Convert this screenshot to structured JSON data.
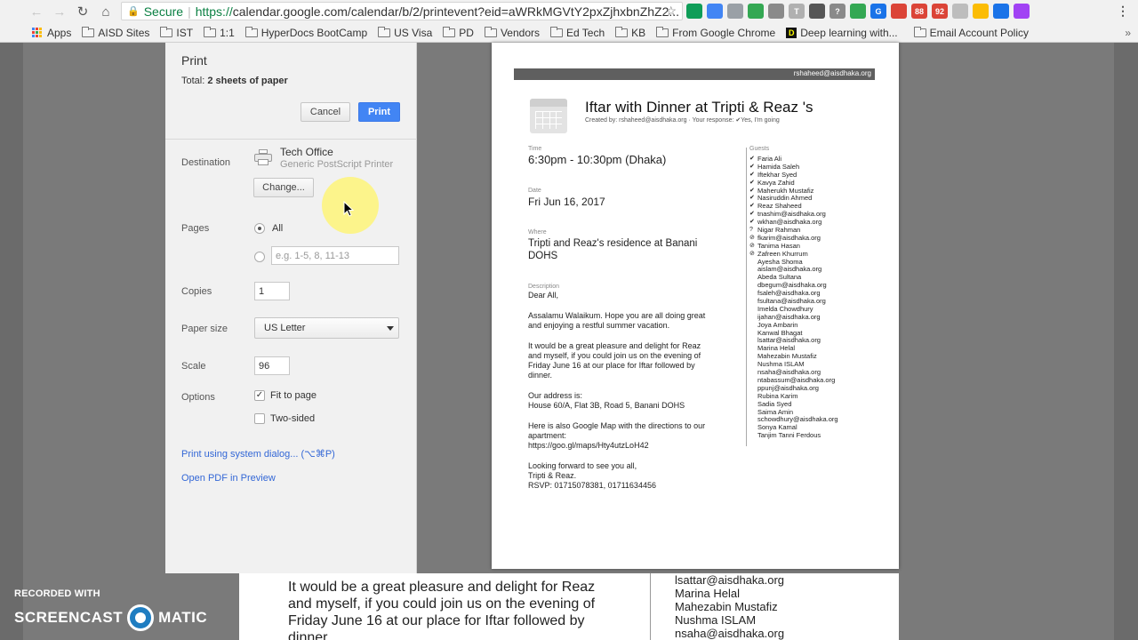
{
  "browser": {
    "secure_label": "Secure",
    "url_scheme": "https://",
    "url_rest": "calendar.google.com/calendar/b/2/printevent?eid=aWRkMGVtY2pxZjhxbnZhZ2...",
    "extensions": [
      {
        "name": "ext-green",
        "color": "#0f9d58",
        "text": ""
      },
      {
        "name": "ext-blue",
        "color": "#4285f4",
        "text": ""
      },
      {
        "name": "ext-grey",
        "color": "#9aa0a6",
        "text": ""
      },
      {
        "name": "ext-chrome",
        "color": "#34a853",
        "text": ""
      },
      {
        "name": "ext-pocket",
        "color": "#8a8a8a",
        "text": ""
      },
      {
        "name": "ext-t",
        "color": "#b0b0b0",
        "text": "T"
      },
      {
        "name": "ext-film",
        "color": "#555555",
        "text": ""
      },
      {
        "name": "ext-help",
        "color": "#8a8a8a",
        "text": "?"
      },
      {
        "name": "ext-leaf",
        "color": "#34a853",
        "text": ""
      },
      {
        "name": "ext-g",
        "color": "#1a73e8",
        "text": "G"
      },
      {
        "name": "ext-red",
        "color": "#db4437",
        "text": ""
      },
      {
        "name": "ext-gmail-88",
        "color": "#db4437",
        "text": "88"
      },
      {
        "name": "ext-gmail-92",
        "color": "#db4437",
        "text": "92"
      },
      {
        "name": "ext-clock",
        "color": "#bdbdbd",
        "text": ""
      },
      {
        "name": "ext-drive",
        "color": "#fbbc05",
        "text": ""
      },
      {
        "name": "ext-meet",
        "color": "#1a73e8",
        "text": ""
      },
      {
        "name": "ext-purple",
        "color": "#a142f4",
        "text": ""
      }
    ]
  },
  "bookmarks": {
    "apps": "Apps",
    "items": [
      "AISD Sites",
      "IST",
      "1:1",
      "HyperDocs BootCamp",
      "US Visa",
      "PD",
      "Vendors",
      "Ed Tech",
      "KB",
      "From Google Chrome"
    ],
    "deep_learning": "Deep learning with...",
    "last": "Email Account Policy"
  },
  "print": {
    "title": "Print",
    "total_prefix": "Total: ",
    "total_value": "2 sheets of paper",
    "cancel": "Cancel",
    "print": "Print",
    "destination_label": "Destination",
    "printer_name": "Tech Office",
    "printer_type": "Generic PostScript Printer",
    "change": "Change...",
    "pages_label": "Pages",
    "pages_all": "All",
    "pages_placeholder": "e.g. 1-5, 8, 11-13",
    "copies_label": "Copies",
    "copies_value": "1",
    "paper_label": "Paper size",
    "paper_value": "US Letter",
    "scale_label": "Scale",
    "scale_value": "96",
    "options_label": "Options",
    "fit_to_page": "Fit to page",
    "two_sided": "Two-sided",
    "system_dialog": "Print using system dialog... (⌥⌘P)",
    "open_pdf": "Open PDF in Preview"
  },
  "preview": {
    "header_email": "rshaheed@aisdhaka.org",
    "title": "Iftar with Dinner at Tripti & Reaz 's",
    "meta": "Created by: rshaheed@aisdhaka.org  ·  Your response: ✔Yes, I'm going",
    "time_label": "Time",
    "time": "6:30pm - 10:30pm (Dhaka)",
    "date_label": "Date",
    "date": "Fri Jun 16, 2017",
    "where_label": "Where",
    "where": "Tripti and Reaz's residence at Banani DOHS",
    "description_label": "Description",
    "description": [
      [
        "Dear All,"
      ],
      [
        "Assalamu Walaikum. Hope you are all doing great",
        "and enjoying a restful summer vacation."
      ],
      [
        "It would be a great pleasure and delight for Reaz",
        "and myself, if you could join us on the evening of",
        "Friday June 16 at our place for Iftar followed by",
        "dinner."
      ],
      [
        "Our address is:",
        "House 60/A, Flat 3B, Road 5, Banani DOHS"
      ],
      [
        "Here is also Google Map with the directions to our",
        "apartment:",
        "https://goo.gl/maps/Hty4utzLoH42"
      ],
      [
        "Looking forward to see you all,",
        "Tripti & Reaz.",
        "RSVP: 01715078381, 01711634456"
      ]
    ],
    "guests_label": "Guests",
    "guests": [
      {
        "mark": "✔",
        "name": "Faria Ali"
      },
      {
        "mark": "✔",
        "name": "Hamida Saleh"
      },
      {
        "mark": "✔",
        "name": "Iftekhar Syed"
      },
      {
        "mark": "✔",
        "name": "Kavya Zahid"
      },
      {
        "mark": "✔",
        "name": "Maherukh Mustafiz"
      },
      {
        "mark": "✔",
        "name": "Nasiruddin Ahmed"
      },
      {
        "mark": "✔",
        "name": "Reaz Shaheed"
      },
      {
        "mark": "✔",
        "name": "tnashim@aisdhaka.org"
      },
      {
        "mark": "✔",
        "name": "wkhan@aisdhaka.org"
      },
      {
        "mark": "?",
        "name": "Nigar Rahman"
      },
      {
        "mark": "⊘",
        "name": "fkarim@aisdhaka.org"
      },
      {
        "mark": "⊘",
        "name": "Tanima Hasan"
      },
      {
        "mark": "⊘",
        "name": "Zafreen Khurrum"
      },
      {
        "mark": "",
        "name": "Ayesha Shoma"
      },
      {
        "mark": "",
        "name": "aislam@aisdhaka.org"
      },
      {
        "mark": "",
        "name": "Abeda Sultana"
      },
      {
        "mark": "",
        "name": "dbegum@aisdhaka.org"
      },
      {
        "mark": "",
        "name": "fsaleh@aisdhaka.org"
      },
      {
        "mark": "",
        "name": "fsultana@aisdhaka.org"
      },
      {
        "mark": "",
        "name": "Imelda Chowdhury"
      },
      {
        "mark": "",
        "name": "ijahan@aisdhaka.org"
      },
      {
        "mark": "",
        "name": "Joya Ambarin"
      },
      {
        "mark": "",
        "name": "Kanwal Bhagat"
      },
      {
        "mark": "",
        "name": "lsattar@aisdhaka.org"
      },
      {
        "mark": "",
        "name": "Marina Helal"
      },
      {
        "mark": "",
        "name": "Mahezabin Mustafiz"
      },
      {
        "mark": "",
        "name": "Nushma ISLAM"
      },
      {
        "mark": "",
        "name": "nsaha@aisdhaka.org"
      },
      {
        "mark": "",
        "name": "ntabassum@aisdhaka.org"
      },
      {
        "mark": "",
        "name": "ppunj@aisdhaka.org"
      },
      {
        "mark": "",
        "name": "Rubina Karim"
      },
      {
        "mark": "",
        "name": "Sadia Syed"
      },
      {
        "mark": "",
        "name": "Saima Amin"
      },
      {
        "mark": "",
        "name": "schowdhury@aisdhaka.org"
      },
      {
        "mark": "",
        "name": "Sonya Kamal"
      },
      {
        "mark": "",
        "name": "Tanjim Tanni Ferdous"
      }
    ]
  },
  "behind": {
    "desc_lines": [
      "It would be a great pleasure and delight for Reaz",
      "and myself, if you could join us on the evening of",
      "Friday June 16 at our place for Iftar followed by",
      "dinner."
    ],
    "guests": [
      "lsattar@aisdhaka.org",
      "Marina Helal",
      "Mahezabin Mustafiz",
      "Nushma ISLAM",
      "nsaha@aisdhaka.org"
    ]
  },
  "watermark": {
    "recorded": "RECORDED WITH",
    "brand_left": "SCREENCAST",
    "brand_right": "MATIC"
  }
}
